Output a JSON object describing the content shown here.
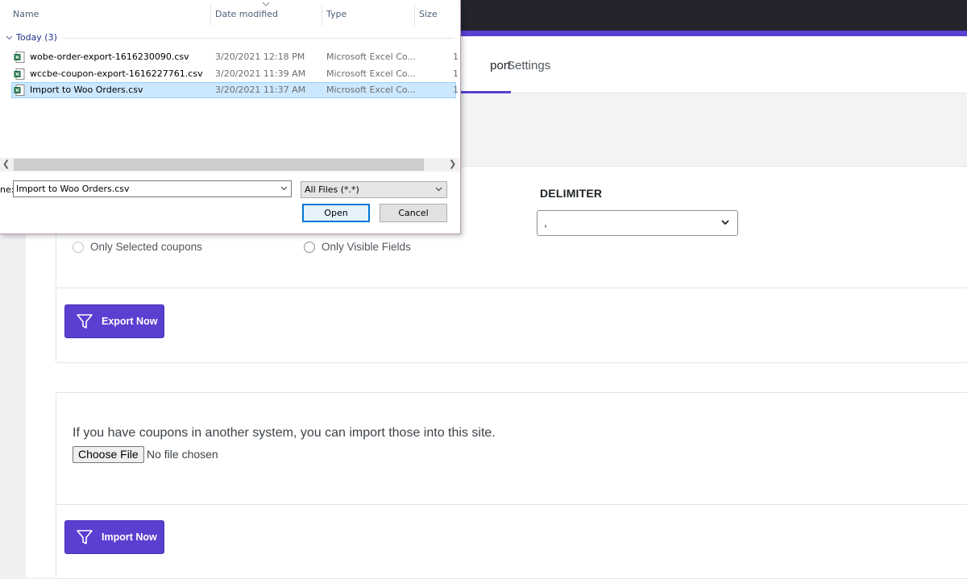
{
  "page": {
    "tabs": [
      {
        "label": "port"
      },
      {
        "label": "Settings"
      }
    ],
    "export": {
      "delimiter_label": "DELIMITER",
      "delimiter_value": ",",
      "options": [
        {
          "label": "Only Selected coupons",
          "selected": false
        },
        {
          "label": "Only Visible Fields",
          "selected": false
        }
      ],
      "button_label": "Export Now"
    },
    "import": {
      "description": "If you have coupons in another system, you can import those into this site.",
      "choose_file_label": "Choose File",
      "no_file_text": "No file chosen",
      "button_label": "Import Now"
    },
    "colors": {
      "accent": "#5a3fd0",
      "topbar": "#23232b"
    }
  },
  "dialog": {
    "columns": {
      "name": "Name",
      "date": "Date modified",
      "type": "Type",
      "size": "Size"
    },
    "group": {
      "label": "Today (3)"
    },
    "files": [
      {
        "name": "wobe-order-export-1616230090.csv",
        "date": "3/20/2021 12:18 PM",
        "type": "Microsoft Excel Co...",
        "size": "1",
        "selected": false,
        "icon": "excel-csv-icon"
      },
      {
        "name": "wccbe-coupon-export-1616227761.csv",
        "date": "3/20/2021 11:39 AM",
        "type": "Microsoft Excel Co...",
        "size": "1",
        "selected": false,
        "icon": "excel-csv-icon"
      },
      {
        "name": "Import to Woo Orders.csv",
        "date": "3/20/2021 11:37 AM",
        "type": "Microsoft Excel Co...",
        "size": "1",
        "selected": true,
        "icon": "excel-csv-icon"
      }
    ],
    "filename_label": "ne:",
    "filename_value": "Import to Woo Orders.csv",
    "filter_value": "All Files (*.*)",
    "open_label": "Open",
    "cancel_label": "Cancel"
  }
}
